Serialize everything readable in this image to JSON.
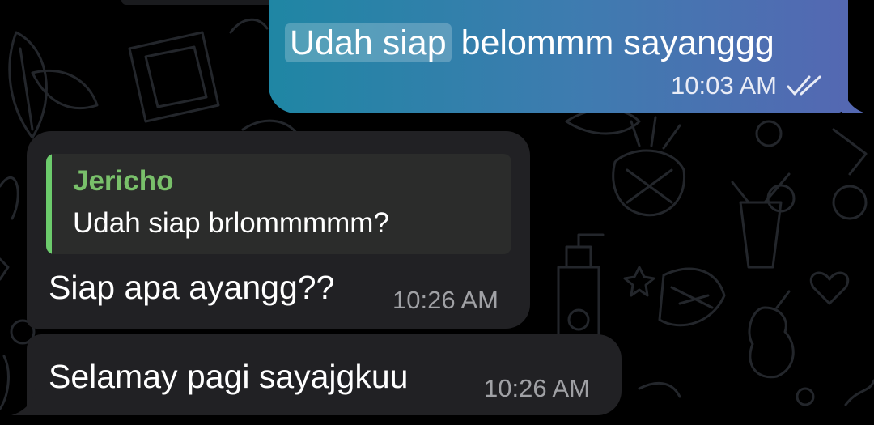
{
  "chat": {
    "outgoing": {
      "text_highlighted": "Udah siap",
      "text_rest": " belommm sayanggg",
      "time": "10:03 AM",
      "status_icon": "double-check-icon"
    },
    "incoming": [
      {
        "reply": {
          "name": "Jericho",
          "text": "Udah siap brlommmmm?"
        },
        "text": "Siap apa ayangg??",
        "time": "10:26 AM"
      },
      {
        "text": "Selamay pagi sayajgkuu",
        "time": "10:26 AM"
      }
    ]
  },
  "colors": {
    "background": "#000000",
    "outgoing_gradient_start": "#1f86a4",
    "outgoing_gradient_end": "#5468b2",
    "incoming_bubble": "#212124",
    "reply_accent": "#6ccb6c",
    "reply_name": "#79c06a"
  }
}
